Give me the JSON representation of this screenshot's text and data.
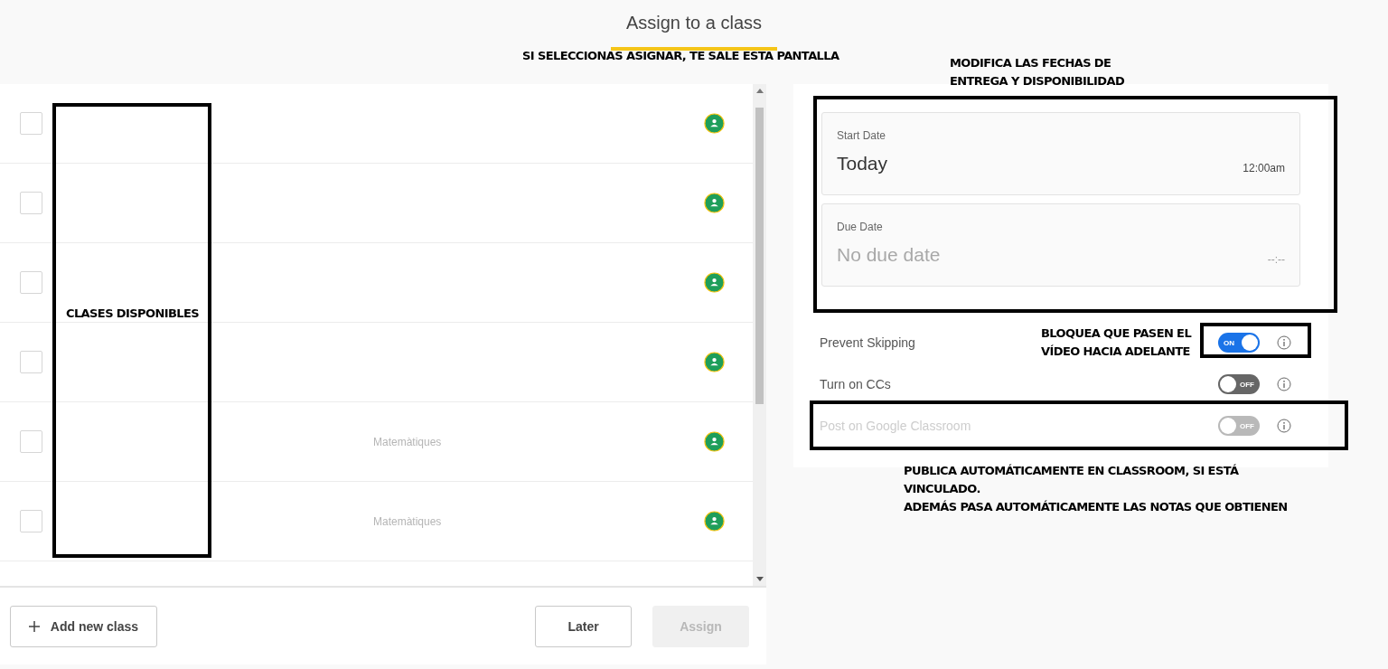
{
  "header": {
    "title": "Assign to a class"
  },
  "classes": [
    {
      "checked": false
    },
    {
      "checked": false
    },
    {
      "checked": false
    },
    {
      "checked": false
    },
    {
      "checked": false,
      "subject": "Matemàtiques"
    },
    {
      "checked": false,
      "subject": "Matemàtiques"
    }
  ],
  "footer": {
    "add_button": "Add new class",
    "later_button": "Later",
    "assign_button": {
      "label": "Assign",
      "disabled": true
    }
  },
  "schedule": {
    "start": {
      "label": "Start Date",
      "value": "Today",
      "time": "12:00am"
    },
    "due": {
      "label": "Due Date",
      "placeholder": "No due date",
      "time": "--:--"
    }
  },
  "settings": [
    {
      "label": "Prevent Skipping",
      "on": true,
      "disabled": false,
      "toggle_text": "ON"
    },
    {
      "label": "Turn on CCs",
      "on": false,
      "disabled": false,
      "toggle_text": "OFF"
    },
    {
      "label": "Post on Google Classroom",
      "on": false,
      "disabled": true,
      "toggle_text": "OFF"
    }
  ],
  "annotations": {
    "banner": "SI SELECCIONAS ASIGNAR, TE SALE ESTA PANTALLA",
    "dates_note": [
      "MODIFICA LAS FECHAS DE",
      "ENTREGA Y DISPONIBILIDAD"
    ],
    "classes_label": "CLASES DISPONIBLES",
    "skip_note": [
      "BLOQUEA QUE PASEN EL",
      "VÍDEO HACIA ADELANTE"
    ],
    "classroom_note": [
      "PUBLICA AUTOMÁTICAMENTE EN CLASSROOM, SI ESTÁ",
      "VINCULADO.",
      "ADEMÁS PASA AUTOMÁTICAMENTE LAS NOTAS QUE OBTIENEN"
    ]
  }
}
